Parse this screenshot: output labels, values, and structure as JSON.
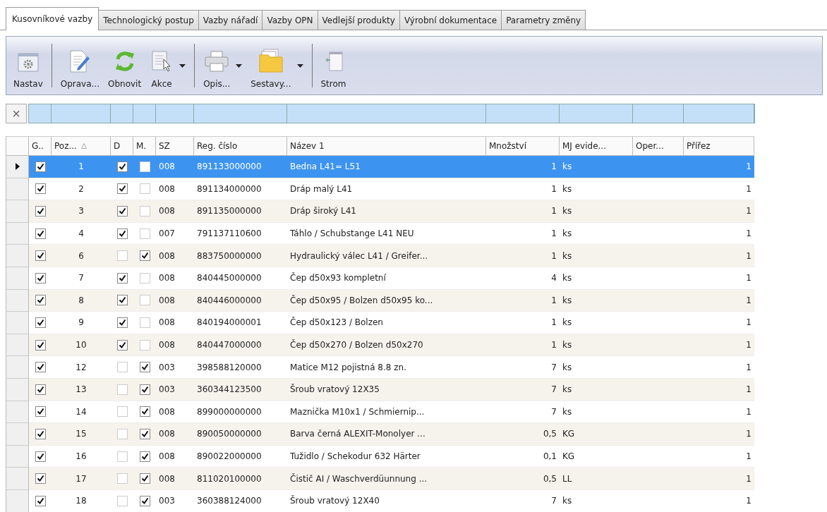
{
  "tabs": [
    {
      "label": "Kusovníkové vazby",
      "selected": true
    },
    {
      "label": "Technologický postup",
      "selected": false
    },
    {
      "label": "Vazby nářadí",
      "selected": false
    },
    {
      "label": "Vazby OPN",
      "selected": false
    },
    {
      "label": "Vedlejší produkty",
      "selected": false
    },
    {
      "label": "Výrobní dokumentace",
      "selected": false
    },
    {
      "label": "Parametry změny",
      "selected": false
    }
  ],
  "toolbar": [
    {
      "buttons": [
        {
          "label": "Nastav",
          "dropdown": false
        }
      ]
    },
    {
      "buttons": [
        {
          "label": "Oprava...",
          "dropdown": false
        },
        {
          "label": "Obnovit",
          "dropdown": false
        },
        {
          "label": "Akce",
          "dropdown": true
        }
      ]
    },
    {
      "buttons": [
        {
          "label": "Opis...",
          "dropdown": true
        },
        {
          "label": "Sestavy...",
          "dropdown": true
        }
      ]
    },
    {
      "buttons": [
        {
          "label": "Strom",
          "dropdown": false
        }
      ]
    }
  ],
  "filter_row": {
    "clear_button": "×"
  },
  "table": {
    "columns": [
      "G..",
      "Poz...",
      "D",
      "M.",
      "SZ",
      "Reg. číslo",
      "Název 1",
      "Množství",
      "MJ evide...",
      "Oper...",
      "Přířez"
    ],
    "rows": [
      {
        "g": true,
        "poz": "1",
        "d": true,
        "m": false,
        "sz": "008",
        "reg": "891133000000",
        "nazev": "Bedna L41= L51",
        "mnozstvi": "1",
        "mj": "ks",
        "prirez": "1",
        "selected": true
      },
      {
        "g": true,
        "poz": "2",
        "d": true,
        "m": false,
        "sz": "008",
        "reg": "891134000000",
        "nazev": "Dráp malý L41",
        "mnozstvi": "1",
        "mj": "ks",
        "prirez": "1",
        "selected": false
      },
      {
        "g": true,
        "poz": "3",
        "d": true,
        "m": false,
        "sz": "008",
        "reg": "891135000000",
        "nazev": "Dráp široký L41",
        "mnozstvi": "1",
        "mj": "ks",
        "prirez": "1",
        "selected": false
      },
      {
        "g": true,
        "poz": "4",
        "d": true,
        "m": false,
        "sz": "007",
        "reg": "791137110600",
        "nazev": "Táhlo / Schubstange L41 NEU",
        "mnozstvi": "1",
        "mj": "ks",
        "prirez": "1",
        "selected": false
      },
      {
        "g": true,
        "poz": "6",
        "d": false,
        "m": true,
        "sz": "008",
        "reg": "883750000000",
        "nazev": "Hydraulický válec L41 / Greifer...",
        "mnozstvi": "1",
        "mj": "ks",
        "prirez": "1",
        "selected": false
      },
      {
        "g": true,
        "poz": "7",
        "d": true,
        "m": false,
        "sz": "008",
        "reg": "840445000000",
        "nazev": "Čep d50x93 kompletní",
        "mnozstvi": "4",
        "mj": "ks",
        "prirez": "1",
        "selected": false
      },
      {
        "g": true,
        "poz": "8",
        "d": true,
        "m": false,
        "sz": "008",
        "reg": "840446000000",
        "nazev": "Čep d50x95 / Bolzen d50x95 ko...",
        "mnozstvi": "1",
        "mj": "ks",
        "prirez": "1",
        "selected": false
      },
      {
        "g": true,
        "poz": "9",
        "d": true,
        "m": false,
        "sz": "008",
        "reg": "840194000001",
        "nazev": "Čep d50x123 / Bolzen",
        "mnozstvi": "1",
        "mj": "ks",
        "prirez": "1",
        "selected": false
      },
      {
        "g": true,
        "poz": "10",
        "d": true,
        "m": false,
        "sz": "008",
        "reg": "840447000000",
        "nazev": "Čep d50x270 / Bolzen d50x270",
        "mnozstvi": "1",
        "mj": "ks",
        "prirez": "1",
        "selected": false
      },
      {
        "g": true,
        "poz": "12",
        "d": false,
        "m": true,
        "sz": "003",
        "reg": "398588120000",
        "nazev": "Matice M12 pojistná 8.8 zn.",
        "mnozstvi": "7",
        "mj": "ks",
        "prirez": "1",
        "selected": false
      },
      {
        "g": true,
        "poz": "13",
        "d": false,
        "m": true,
        "sz": "003",
        "reg": "360344123500",
        "nazev": "Šroub vratový 12X35",
        "mnozstvi": "7",
        "mj": "ks",
        "prirez": "1",
        "selected": false
      },
      {
        "g": true,
        "poz": "14",
        "d": false,
        "m": true,
        "sz": "008",
        "reg": "899000000000",
        "nazev": "Maznička M10x1 / Schmiernip...",
        "mnozstvi": "7",
        "mj": "ks",
        "prirez": "1",
        "selected": false
      },
      {
        "g": true,
        "poz": "15",
        "d": false,
        "m": true,
        "sz": "008",
        "reg": "890050000000",
        "nazev": "Barva černá ALEXIT-Monolyer ...",
        "mnozstvi": "0,5",
        "mj": "KG",
        "prirez": "1",
        "selected": false
      },
      {
        "g": true,
        "poz": "16",
        "d": false,
        "m": true,
        "sz": "008",
        "reg": "890022000000",
        "nazev": "Tužidlo / Schekodur 632 Härter",
        "mnozstvi": "0,1",
        "mj": "KG",
        "prirez": "1",
        "selected": false
      },
      {
        "g": true,
        "poz": "17",
        "d": false,
        "m": true,
        "sz": "008",
        "reg": "811020100000",
        "nazev": "Čistič AI / Waschverdüunnung ...",
        "mnozstvi": "0,5",
        "mj": "LL",
        "prirez": "1",
        "selected": false
      },
      {
        "g": true,
        "poz": "18",
        "d": false,
        "m": true,
        "sz": "003",
        "reg": "360388124000",
        "nazev": "Šroub vratový 12X40",
        "mnozstvi": "7",
        "mj": "ks",
        "prirez": "1",
        "selected": false
      }
    ]
  }
}
